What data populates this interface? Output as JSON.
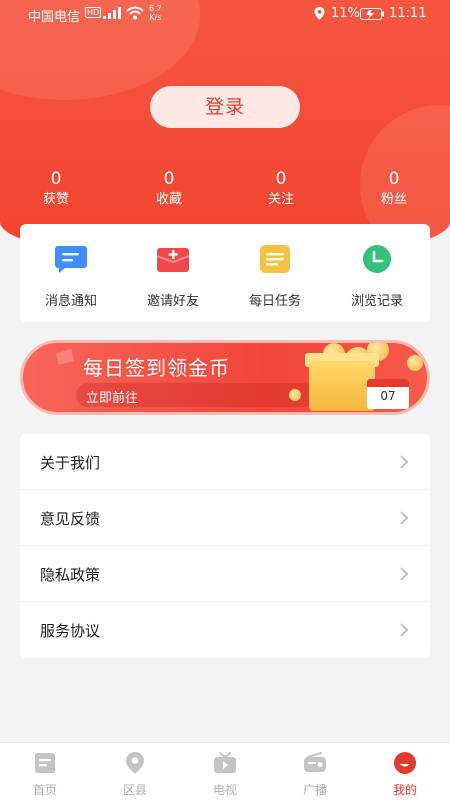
{
  "status_bar": {
    "carrier": "中国电信",
    "hd": "HD",
    "speed_value": "6.7",
    "speed_unit": "K/s",
    "battery": "11%",
    "time": "11:11"
  },
  "login": {
    "label": "登录"
  },
  "stats": [
    {
      "value": "0",
      "label": "获赞"
    },
    {
      "value": "0",
      "label": "收藏"
    },
    {
      "value": "0",
      "label": "关注"
    },
    {
      "value": "0",
      "label": "粉丝"
    }
  ],
  "quick_actions": [
    {
      "label": "消息通知",
      "icon": "message-icon",
      "color": "#3f8ef5"
    },
    {
      "label": "邀请好友",
      "icon": "invite-icon",
      "color": "#ef4a4a"
    },
    {
      "label": "每日任务",
      "icon": "task-icon",
      "color": "#f6c142"
    },
    {
      "label": "浏览记录",
      "icon": "history-icon",
      "color": "#32c27a"
    }
  ],
  "banner": {
    "title": "每日签到领金币",
    "subtitle": "立即前往",
    "calendar_day": "07"
  },
  "menu": [
    {
      "label": "关于我们"
    },
    {
      "label": "意见反馈"
    },
    {
      "label": "隐私政策"
    },
    {
      "label": "服务协议"
    }
  ],
  "tabs": [
    {
      "label": "首页",
      "icon": "home-icon",
      "active": false
    },
    {
      "label": "区县",
      "icon": "location-icon",
      "active": false
    },
    {
      "label": "电视",
      "icon": "tv-icon",
      "active": false
    },
    {
      "label": "广播",
      "icon": "radio-icon",
      "active": false
    },
    {
      "label": "我的",
      "icon": "profile-icon",
      "active": true
    }
  ],
  "colors": {
    "primary": "#f2442f",
    "tab_active": "#e63a2e",
    "tab_inactive": "#b0b0b0"
  }
}
